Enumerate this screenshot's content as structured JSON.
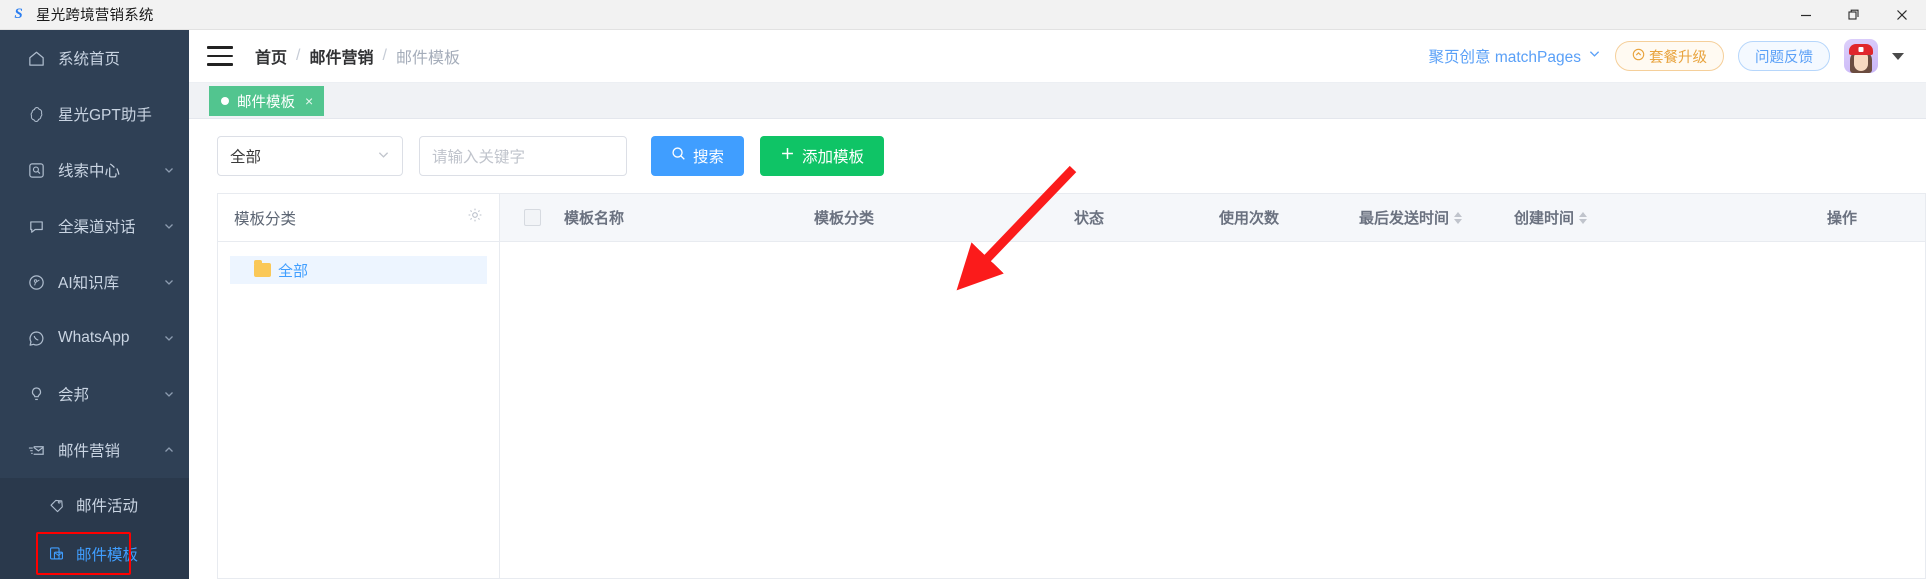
{
  "window": {
    "title": "星光跨境营销系统",
    "logo_text": "S",
    "controls": {
      "minimize": "—",
      "restore": "❐",
      "close": "✕"
    }
  },
  "sidebar": {
    "items": [
      {
        "label": "系统首页",
        "icon": "home-icon",
        "chevron": "",
        "expandable": false
      },
      {
        "label": "星光GPT助手",
        "icon": "gpt-icon",
        "chevron": "",
        "expandable": false
      },
      {
        "label": "线索中心",
        "icon": "lead-icon",
        "chevron": "⌄",
        "expandable": true
      },
      {
        "label": "全渠道对话",
        "icon": "chat-icon",
        "chevron": "⌄",
        "expandable": true
      },
      {
        "label": "AI知识库",
        "icon": "brain-icon",
        "chevron": "⌄",
        "expandable": true
      },
      {
        "label": "WhatsApp",
        "icon": "whatsapp-icon",
        "chevron": "⌄",
        "expandable": true
      },
      {
        "label": "会邦",
        "icon": "bulb-icon",
        "chevron": "⌄",
        "expandable": true
      },
      {
        "label": "邮件营销",
        "icon": "mail-send-icon",
        "chevron": "⌃",
        "expandable": true
      }
    ],
    "submenu": [
      {
        "label": "邮件活动",
        "icon": "tag-icon",
        "active": false
      },
      {
        "label": "邮件模板",
        "icon": "template-icon",
        "active": true
      }
    ]
  },
  "header": {
    "breadcrumbs": [
      {
        "label": "首页",
        "current": false
      },
      {
        "label": "邮件营销",
        "current": false
      },
      {
        "label": "邮件模板",
        "current": true
      }
    ],
    "separator": "/",
    "account_switcher": {
      "label": "聚页创意 matchPages",
      "chevron": "⌄"
    },
    "upgrade_button": {
      "label": "套餐升级",
      "icon": "upgrade-icon"
    },
    "feedback_button": {
      "label": "问题反馈"
    }
  },
  "tabs": [
    {
      "label": "邮件模板",
      "closable": true,
      "close_label": "×",
      "active": true
    }
  ],
  "toolbar": {
    "category_select": {
      "value": "全部",
      "chevron": "⌄"
    },
    "keyword_input": {
      "value": "",
      "placeholder": "请输入关键字"
    },
    "search_button": {
      "label": "搜索",
      "icon": "search-icon"
    },
    "add_button": {
      "label": "添加模板",
      "icon": "plus-icon"
    }
  },
  "category_panel": {
    "title": "模板分类",
    "settings_icon": "gear-icon",
    "nodes": [
      {
        "label": "全部",
        "icon": "folder-icon",
        "selected": true
      }
    ]
  },
  "table": {
    "columns": [
      {
        "key": "check",
        "label": "",
        "sortable": false
      },
      {
        "key": "name",
        "label": "模板名称",
        "sortable": false
      },
      {
        "key": "cat",
        "label": "模板分类",
        "sortable": false
      },
      {
        "key": "status",
        "label": "状态",
        "sortable": false
      },
      {
        "key": "usage",
        "label": "使用次数",
        "sortable": false
      },
      {
        "key": "last",
        "label": "最后发送时间",
        "sortable": true
      },
      {
        "key": "create",
        "label": "创建时间",
        "sortable": true
      },
      {
        "key": "ops",
        "label": "操作",
        "sortable": false
      }
    ],
    "rows": []
  },
  "annotation": {
    "arrow_color": "#fb1b1b",
    "points_to": "添加模板"
  },
  "colors": {
    "sidebar_bg": "#2f4055",
    "submenu_bg": "#2a394c",
    "accent_blue": "#409eff",
    "accent_green": "#0fc466",
    "tab_green": "#52c58f",
    "highlight_red": "#ff0000",
    "folder_yellow": "#fac858"
  }
}
